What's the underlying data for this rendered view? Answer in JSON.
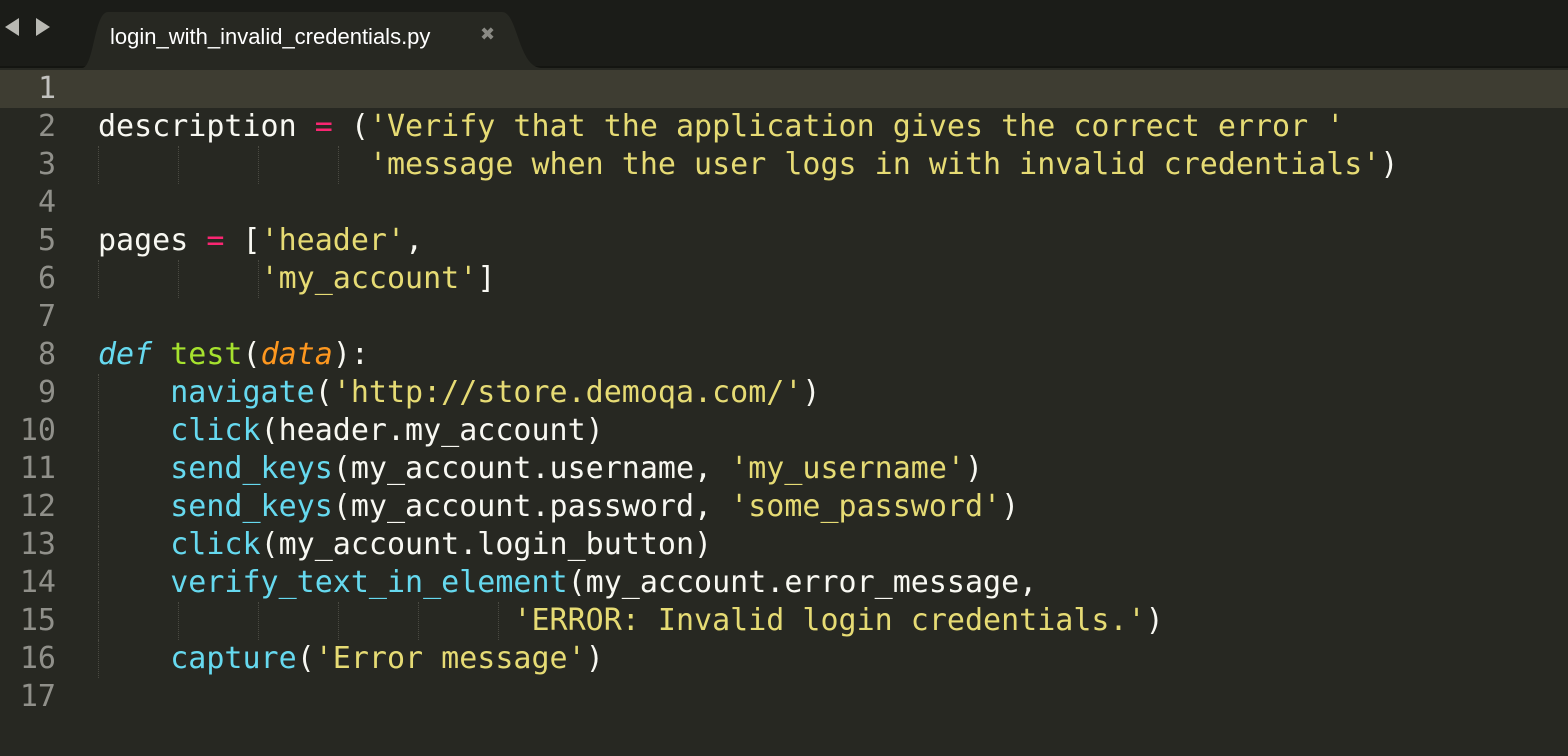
{
  "tab": {
    "filename": "login_with_invalid_credentials.py",
    "close_glyph": "✖"
  },
  "nav": {
    "back_icon": "back-arrow-icon",
    "forward_icon": "forward-arrow-icon"
  },
  "editor": {
    "active_line": 1,
    "line_numbers": [
      "1",
      "2",
      "3",
      "4",
      "5",
      "6",
      "7",
      "8",
      "9",
      "10",
      "11",
      "12",
      "13",
      "14",
      "15",
      "16",
      "17"
    ],
    "lines": [
      {
        "tokens": []
      },
      {
        "tokens": [
          {
            "t": "description ",
            "c": "plain"
          },
          {
            "t": "=",
            "c": "op"
          },
          {
            "t": " (",
            "c": "plain"
          },
          {
            "t": "'Verify that the application gives the correct error '",
            "c": "str"
          }
        ]
      },
      {
        "tokens": [
          {
            "t": "               ",
            "c": "plain"
          },
          {
            "t": "'message when the user logs in with invalid credentials'",
            "c": "str"
          },
          {
            "t": ")",
            "c": "plain"
          }
        ]
      },
      {
        "tokens": []
      },
      {
        "tokens": [
          {
            "t": "pages ",
            "c": "plain"
          },
          {
            "t": "=",
            "c": "op"
          },
          {
            "t": " [",
            "c": "plain"
          },
          {
            "t": "'header'",
            "c": "str"
          },
          {
            "t": ",",
            "c": "plain"
          }
        ]
      },
      {
        "tokens": [
          {
            "t": "         ",
            "c": "plain"
          },
          {
            "t": "'my_account'",
            "c": "str"
          },
          {
            "t": "]",
            "c": "plain"
          }
        ]
      },
      {
        "tokens": []
      },
      {
        "tokens": [
          {
            "t": "def",
            "c": "kw"
          },
          {
            "t": " ",
            "c": "plain"
          },
          {
            "t": "test",
            "c": "fn"
          },
          {
            "t": "(",
            "c": "plain"
          },
          {
            "t": "data",
            "c": "param"
          },
          {
            "t": "):",
            "c": "plain"
          }
        ]
      },
      {
        "tokens": [
          {
            "t": "    ",
            "c": "plain"
          },
          {
            "t": "navigate",
            "c": "call"
          },
          {
            "t": "(",
            "c": "plain"
          },
          {
            "t": "'http://store.demoqa.com/'",
            "c": "str"
          },
          {
            "t": ")",
            "c": "plain"
          }
        ]
      },
      {
        "tokens": [
          {
            "t": "    ",
            "c": "plain"
          },
          {
            "t": "click",
            "c": "call"
          },
          {
            "t": "(header.my_account)",
            "c": "plain"
          }
        ]
      },
      {
        "tokens": [
          {
            "t": "    ",
            "c": "plain"
          },
          {
            "t": "send_keys",
            "c": "call"
          },
          {
            "t": "(my_account.username, ",
            "c": "plain"
          },
          {
            "t": "'my_username'",
            "c": "str"
          },
          {
            "t": ")",
            "c": "plain"
          }
        ]
      },
      {
        "tokens": [
          {
            "t": "    ",
            "c": "plain"
          },
          {
            "t": "send_keys",
            "c": "call"
          },
          {
            "t": "(my_account.password, ",
            "c": "plain"
          },
          {
            "t": "'some_password'",
            "c": "str"
          },
          {
            "t": ")",
            "c": "plain"
          }
        ]
      },
      {
        "tokens": [
          {
            "t": "    ",
            "c": "plain"
          },
          {
            "t": "click",
            "c": "call"
          },
          {
            "t": "(my_account.login_button)",
            "c": "plain"
          }
        ]
      },
      {
        "tokens": [
          {
            "t": "    ",
            "c": "plain"
          },
          {
            "t": "verify_text_in_element",
            "c": "call"
          },
          {
            "t": "(my_account.error_message,",
            "c": "plain"
          }
        ]
      },
      {
        "tokens": [
          {
            "t": "                       ",
            "c": "plain"
          },
          {
            "t": "'ERROR: Invalid login credentials.'",
            "c": "str"
          },
          {
            "t": ")",
            "c": "plain"
          }
        ]
      },
      {
        "tokens": [
          {
            "t": "    ",
            "c": "plain"
          },
          {
            "t": "capture",
            "c": "call"
          },
          {
            "t": "(",
            "c": "plain"
          },
          {
            "t": "'Error message'",
            "c": "str"
          },
          {
            "t": ")",
            "c": "plain"
          }
        ]
      },
      {
        "tokens": []
      }
    ]
  },
  "colors": {
    "background": "#272822",
    "string": "#e6db74",
    "operator": "#f92672",
    "keyword": "#66d9ef",
    "function_name": "#a6e22e",
    "parameter": "#fd971f",
    "default_text": "#f8f8f2"
  }
}
